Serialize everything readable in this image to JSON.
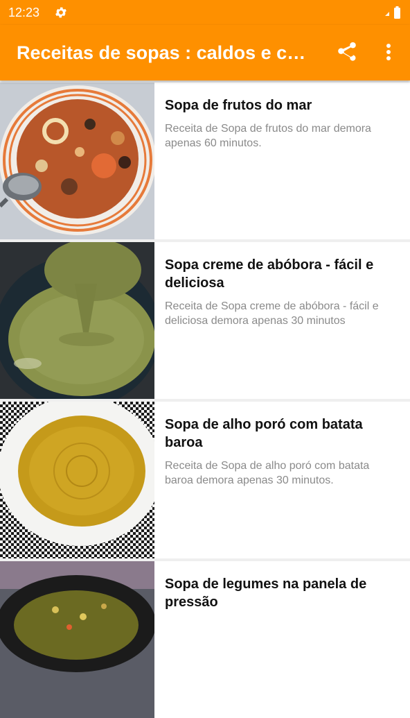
{
  "status_bar": {
    "time": "12:23",
    "settings_icon": "gear-icon",
    "battery_icon": "battery-icon"
  },
  "app_bar": {
    "title": "Receitas de sopas : caldos e caldinhos",
    "share_icon": "share-icon",
    "menu_icon": "more-vert-icon",
    "color": "#fe9000"
  },
  "recipes": [
    {
      "title": "Sopa de frutos do mar",
      "description": "Receita de Sopa de frutos do mar demora apenas 60 minutos."
    },
    {
      "title": "Sopa creme de abóbora - fácil e deliciosa",
      "description": "Receita de Sopa creme de abóbora - fácil e deliciosa demora apenas 30 minutos"
    },
    {
      "title": "Sopa de alho poró com batata baroa",
      "description": "Receita de Sopa de alho poró com batata baroa demora apenas 30 minutos."
    },
    {
      "title": "Sopa de legumes na panela de pressão",
      "description": ""
    }
  ]
}
